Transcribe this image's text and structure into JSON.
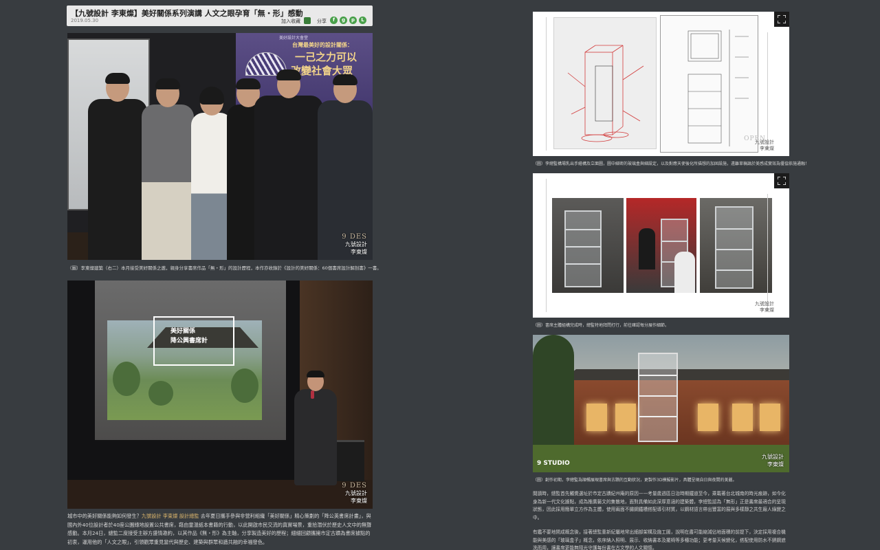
{
  "article": {
    "title": "【九號設計 李東燦】美好關係系列演講 人文之眼孕育「無・形」感動",
    "date": "2019.05.30",
    "favorite_label": "加入收藏",
    "share_label": "分享",
    "share_icons": [
      "facebook-icon",
      "google-plus-icon",
      "plurk-icon",
      "line-icon"
    ]
  },
  "photo1": {
    "banner_pre": "美好設計大會堂",
    "banner_line1": "台灣最美好的設計關係：",
    "banner_line2": "一己之力可以",
    "banner_line3": "改變社會大眾",
    "watermark_brand": "9 DES",
    "watermark_line1": "九號設計",
    "watermark_line2": "李東燦",
    "caption": "（圖）李東燦建築（右二）本月接受美好關係之邀，親身分享書席作品「無・形」的設計歷程，本作亦收錄於《設計的美好關係：60個書席設計解剖書》一書。"
  },
  "photo2": {
    "screen_text1": "美好關係",
    "screen_text2": "降公興書席計",
    "watermark_brand": "9 DES",
    "watermark_line1": "九號設計",
    "watermark_line2": "李東燦"
  },
  "body_text": {
    "part1": "城市中的美好關係能夠如何發生？",
    "highlight": "九號設計 李東燦 設計總監",
    "part2": " 去年夏日攜手參與非營利組織「美好關係」精心策劃的「降公英書席計畫」，與國內外40位設計者於40座公園綠地設置公共書席，藉由童溫紙本書籍的行動，以此開啟市民交流的真實場景，重拾潛伏於歷史人文中的無聲感動。本月24日，總監二度接受主辦方盛情邀約，以其作品《無・形》為主軸，分享製造美好的歷程；細細回顧攜擁市定古蹟為書席據點的初衷，運用他的「人文之眼」，引領觀眾重見當代與歷史、建築與群眾和諧共融的幸福發色。"
  },
  "panel1": {
    "caption": "（圖）李總監構場乳出手繪構及立面圖，圖中細密的玻璃盒與細設定，以及對應天使後化所描想的加固設施，遠離草稿論於美感成實效為優協依施通融！",
    "mark_line1": "九號設計",
    "mark_line2": "李東燦",
    "logo": "OPEN"
  },
  "panel2": {
    "caption": "（圖）書席主體組構完成時，總監特地拜問打行，前往確認每分展作細節。",
    "mark_line1": "九號設計",
    "mark_line2": "李東燦"
  },
  "panel3": {
    "logo": "9 STUDIO",
    "mark_line1": "九號設計",
    "mark_line2": "李東燦",
    "caption": "（圖）創作初期，李總監為順暢展現書席與古蹟的互動狀況，更製作3D模擬影片，具體呈現自日與夜間的美麗。"
  },
  "right_body": {
    "para1": "閱讀時，總監首先觸覺選址於市定古蹟紀州庵的原因——考量歲週區日治時期鐵道至今，乘載著台北城南的時光痕跡，如今化身為新一代文化據點，成為推廣藝文的集散地，面對具備如此深厚意涵的建築體，李總監認為「無形」正是書席最適合的呈現狀態，因此採用簡單立方作為主體，使用兩面不鏽鋼鐵槽搭配導引材質，以鋼材語言帶出豐富的展與多樣靜之共生廠人綠變之中。",
    "para2": "有鑑不要地開成概念後，接著總監重新紀屬地常出細部架構及施工圖，說明在盡可能縮減佔地面積的前提下，決定採用複合機能與美感的「玻璃盒子」概念，依序納入照明、展示、收納書本及擺椅等多種功能；更考量天候變化，搭配使用防水不銹鋼遮洗而用，讓書席更能無阻光守護每份書在古文學的人文關懷。"
  }
}
